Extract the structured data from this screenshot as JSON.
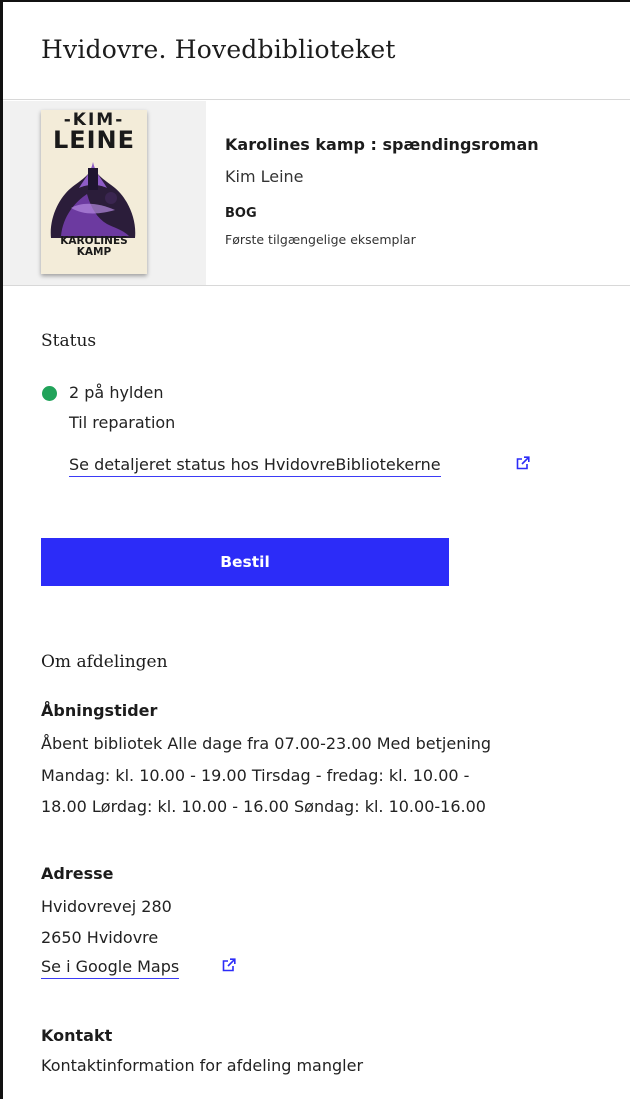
{
  "header": {
    "title": "Hvidovre. Hovedbiblioteket"
  },
  "book": {
    "cover": {
      "author_line1": "-KIM-",
      "author_line2": "LEINE",
      "title_line1": "KAROLINES",
      "title_line2": "KAMP"
    },
    "title": "Karolines kamp : spændingsroman",
    "author": "Kim Leine",
    "type": "BOG",
    "note": "Første tilgængelige eksemplar"
  },
  "status": {
    "heading": "Status",
    "availability": "2 på hylden",
    "sub": "Til reparation",
    "detail_link": "Se detaljeret status hos HvidovreBibliotekerne",
    "indicator_color": "#21a35a"
  },
  "actions": {
    "order_button": "Bestil",
    "accent": "#2c2cf8"
  },
  "department": {
    "heading": "Om afdelingen",
    "hours_label": "Åbningstider",
    "hours_lines": [
      "Åbent bibliotek Alle dage fra 07.00-23.00 Med betjening",
      "Mandag: kl. 10.00 - 19.00 Tirsdag - fredag: kl. 10.00 -",
      "18.00 Lørdag: kl. 10.00 - 16.00 Søndag: kl. 10.00-16.00"
    ],
    "address_label": "Adresse",
    "address_street": "Hvidovrevej 280",
    "address_city": "2650 Hvidovre",
    "maps_link": "Se i Google Maps",
    "contact_label": "Kontakt",
    "contact_text": "Kontaktinformation for afdeling mangler"
  },
  "icons": {
    "external_link": "external-link-icon",
    "status_dot": "status-dot-icon"
  }
}
